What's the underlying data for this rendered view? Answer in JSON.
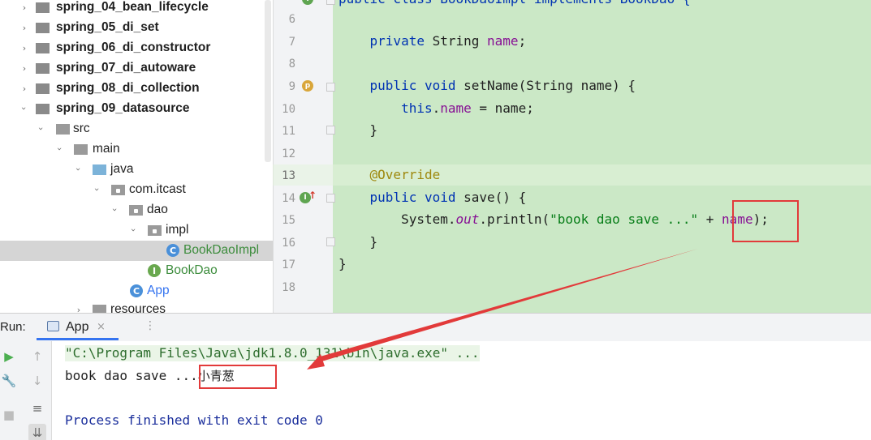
{
  "project_tree": {
    "items": [
      {
        "label": "spring_04_bean_lifecycle",
        "expanded": false
      },
      {
        "label": "spring_05_di_set",
        "expanded": false
      },
      {
        "label": "spring_06_di_constructor",
        "expanded": false
      },
      {
        "label": "spring_07_di_autoware",
        "expanded": false
      },
      {
        "label": "spring_08_di_collection",
        "expanded": false
      },
      {
        "label": "spring_09_datasource",
        "expanded": true
      },
      {
        "label": "src"
      },
      {
        "label": "main"
      },
      {
        "label": "java"
      },
      {
        "label": "com.itcast"
      },
      {
        "label": "dao"
      },
      {
        "label": "impl"
      },
      {
        "label": "BookDaoImpl",
        "selected": true
      },
      {
        "label": "BookDao"
      },
      {
        "label": "App"
      },
      {
        "label": "resources"
      }
    ]
  },
  "editor": {
    "line_numbers": [
      "6",
      "7",
      "8",
      "9",
      "10",
      "11",
      "12",
      "13",
      "14",
      "15",
      "16",
      "17",
      "18"
    ],
    "top_partial_code": "public class BookDaoImpl implements BookDao {",
    "code": {
      "l7_kw": "private",
      "l7_type": " String ",
      "l7_field": "name",
      "l7_end": ";",
      "l9_kw": "public void",
      "l9_rest": " setName(String name) {",
      "l10_kw": "this",
      "l10_dot": ".",
      "l10_field": "name",
      "l10_rest": " = name;",
      "l11": "}",
      "l13_ann": "@Override",
      "l14_kw": "public void",
      "l14_rest": " save() {",
      "l15_a": "System.",
      "l15_out": "out",
      "l15_b": ".println(",
      "l15_str": "\"book dao save ...\"",
      "l15_c": " + ",
      "l15_field": "name",
      "l15_d": ");",
      "l16": "}",
      "l17": "}"
    },
    "gutter_icons": {
      "l9": "p",
      "l14": "I"
    }
  },
  "run_panel": {
    "label": "Run:",
    "tab_title": "App",
    "close_glyph": "×",
    "dots": "⋮",
    "console": {
      "command": "\"C:\\Program Files\\Java\\jdk1.8.0_131\\bin\\java.exe\" ...",
      "output_prefix": "book dao save ...",
      "output_value": "小青葱",
      "exit": "Process finished with exit code 0"
    }
  },
  "colors": {
    "editor_bg": "#cbe8c6",
    "keyword": "#0033b3",
    "field": "#871094",
    "annotation": "#9e880d",
    "string": "#067d17",
    "highlight_box": "#e23a3a"
  }
}
